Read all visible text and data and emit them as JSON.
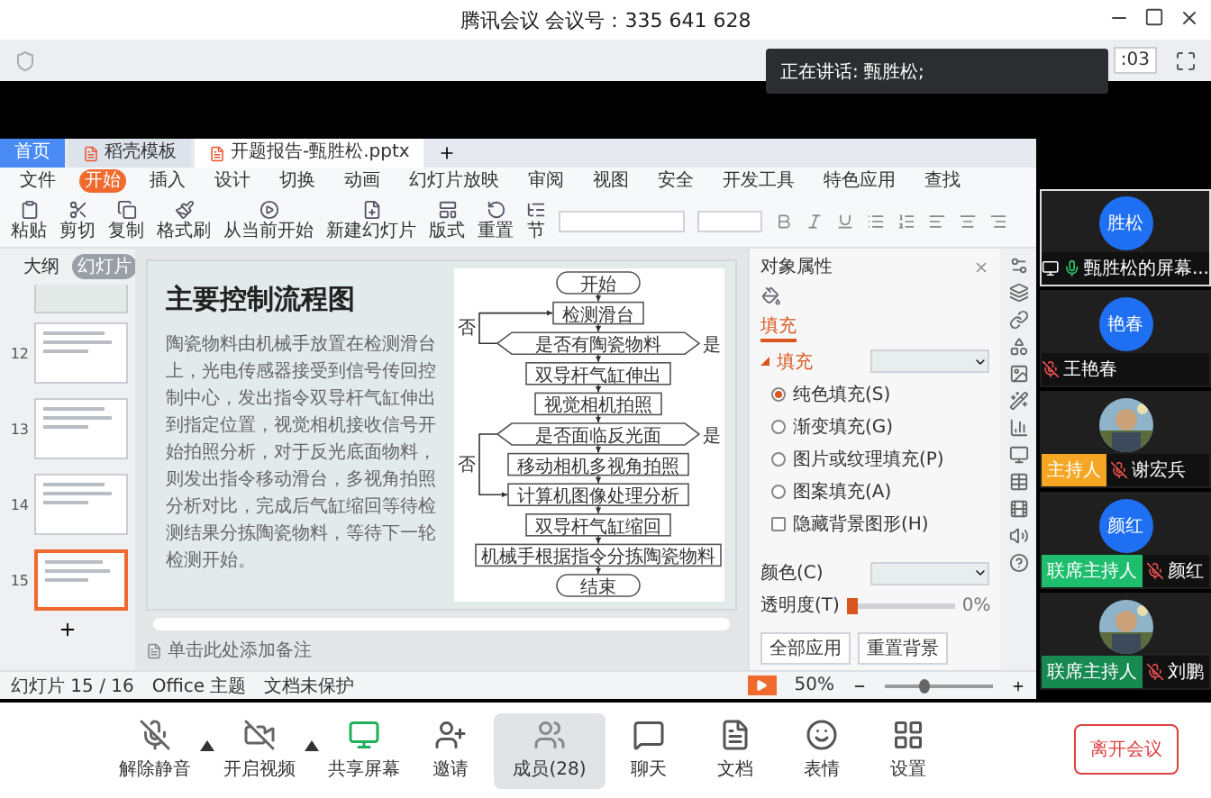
{
  "window": {
    "title": "腾讯会议 会议号：335 641 628",
    "timer": ":03"
  },
  "speaking_tooltip": "正在讲话: 甄胜松;",
  "shared_screen": {
    "app_tabs": [
      {
        "label": "首页",
        "kind": "home",
        "selected": false
      },
      {
        "label": "稻壳模板",
        "kind": "doc",
        "selected": false
      },
      {
        "label": "开题报告-甄胜松.pptx",
        "kind": "doc",
        "selected": true
      }
    ],
    "menu": [
      {
        "label": "文件",
        "selected": false
      },
      {
        "label": "开始",
        "selected": true
      },
      {
        "label": "插入",
        "selected": false
      },
      {
        "label": "设计",
        "selected": false
      },
      {
        "label": "切换",
        "selected": false
      },
      {
        "label": "动画",
        "selected": false
      },
      {
        "label": "幻灯片放映",
        "selected": false
      },
      {
        "label": "审阅",
        "selected": false
      },
      {
        "label": "视图",
        "selected": false
      },
      {
        "label": "安全",
        "selected": false
      },
      {
        "label": "开发工具",
        "selected": false
      },
      {
        "label": "特色应用",
        "selected": false
      },
      {
        "label": "查找",
        "selected": false
      }
    ],
    "ribbon": [
      {
        "label": "粘贴",
        "kind": "paste"
      },
      {
        "label": "剪切",
        "kind": "cut"
      },
      {
        "label": "复制",
        "kind": "copy"
      },
      {
        "label": "格式刷",
        "kind": "format-painter"
      },
      {
        "label": "从当前开始",
        "kind": "play"
      },
      {
        "label": "新建幻灯片",
        "kind": "new-slide"
      },
      {
        "label": "版式",
        "kind": "layout"
      },
      {
        "label": "重置",
        "kind": "reset"
      },
      {
        "label": "节",
        "kind": "section"
      }
    ],
    "thumbnail_tabs": [
      {
        "label": "大纲",
        "selected": false
      },
      {
        "label": "幻灯片",
        "selected": true
      }
    ],
    "thumbnails": [
      {
        "number": "12",
        "selected": false
      },
      {
        "number": "13",
        "selected": false
      },
      {
        "number": "14",
        "selected": false
      },
      {
        "number": "15",
        "selected": true
      }
    ],
    "slide": {
      "title": "主要控制流程图",
      "body": "陶瓷物料由机械手放置在检测滑台上，光电传感器接受到信号传回控制中心，发出指令双导杆气缸伸出到指定位置，视觉相机接收信号开始拍照分析，对于反光底面物料，则发出指令移动滑台，多视角拍照分析对比，完成后气缸缩回等待检测结果分拣陶瓷物料，等待下一轮检测开始。",
      "flowchart": [
        {
          "label": "开始",
          "kind": "terminal"
        },
        {
          "label": "检测滑台",
          "kind": "process"
        },
        {
          "label": "是否有陶瓷物料",
          "kind": "decision",
          "yes_label": "是",
          "no_label": "否"
        },
        {
          "label": "双导杆气缸伸出",
          "kind": "process"
        },
        {
          "label": "视觉相机拍照",
          "kind": "process"
        },
        {
          "label": "是否面临反光面",
          "kind": "decision",
          "yes_label": "是",
          "no_label": "否"
        },
        {
          "label": "移动相机多视角拍照",
          "kind": "process"
        },
        {
          "label": "计算机图像处理分析",
          "kind": "process"
        },
        {
          "label": "双导杆气缸缩回",
          "kind": "process"
        },
        {
          "label": "机械手根据指令分拣陶瓷物料",
          "kind": "process"
        },
        {
          "label": "结束",
          "kind": "terminal"
        }
      ]
    },
    "notes_placeholder": "单击此处添加备注",
    "properties": {
      "title": "对象属性",
      "tab": "填充",
      "section": "填充",
      "options": [
        {
          "label": "纯色填充(S)",
          "kind": "radio",
          "checked": true
        },
        {
          "label": "渐变填充(G)",
          "kind": "radio",
          "checked": false
        },
        {
          "label": "图片或纹理填充(P)",
          "kind": "radio",
          "checked": false
        },
        {
          "label": "图案填充(A)",
          "kind": "radio",
          "checked": false
        },
        {
          "label": "隐藏背景图形(H)",
          "kind": "checkbox",
          "checked": false
        }
      ],
      "color_label": "颜色(C)",
      "transparency": {
        "label": "透明度(T)",
        "reading": "0%",
        "level": 0
      },
      "buttons": [
        "全部应用",
        "重置背景"
      ]
    },
    "status_bar": {
      "slide": "幻灯片 15 / 16",
      "theme": "Office 主题",
      "protection": "文档未保护",
      "zoom": "50%",
      "zoom_slider": {
        "level": 0.35
      }
    }
  },
  "participants": [
    {
      "kind": "initials",
      "avatar_text": "胜松",
      "name": "甄胜松的屏幕...",
      "speaking": true,
      "sharing": true,
      "selected": true
    },
    {
      "kind": "initials",
      "avatar_text": "艳春",
      "name": "王艳春",
      "speaking": false,
      "sharing": false,
      "selected": false
    },
    {
      "name": "谢宏兵",
      "role": {
        "label": "主持人",
        "color": "#f5a623"
      },
      "speaking": false,
      "sharing": false,
      "selected": false
    },
    {
      "kind": "initials",
      "avatar_text": "颜红",
      "name": "颜红",
      "role": {
        "label": "联席主持人",
        "color": "#1fbe6e"
      },
      "speaking": false,
      "sharing": false,
      "selected": false
    },
    {
      "name": "刘鹏",
      "role": {
        "label": "联席主持人",
        "color": "#178a52"
      },
      "speaking": false,
      "sharing": false,
      "selected": false
    }
  ],
  "toolbar": [
    {
      "label": "解除静音",
      "kind": "mic-off",
      "has_menu": true,
      "selected": false
    },
    {
      "label": "开启视频",
      "kind": "video-off",
      "has_menu": true,
      "selected": false
    },
    {
      "label": "共享屏幕",
      "kind": "share",
      "has_menu": false,
      "selected": false
    },
    {
      "label": "邀请",
      "kind": "invite",
      "has_menu": false,
      "selected": false
    },
    {
      "label": "成员(28)",
      "kind": "members",
      "has_menu": false,
      "selected": true
    },
    {
      "label": "聊天",
      "kind": "chat",
      "has_menu": false,
      "selected": false
    },
    {
      "label": "文档",
      "kind": "doc",
      "has_menu": false,
      "selected": false
    },
    {
      "label": "表情",
      "kind": "emoji",
      "has_menu": false,
      "selected": false
    },
    {
      "label": "设置",
      "kind": "settings",
      "has_menu": false,
      "selected": false
    }
  ],
  "leave_button": "离开会议"
}
